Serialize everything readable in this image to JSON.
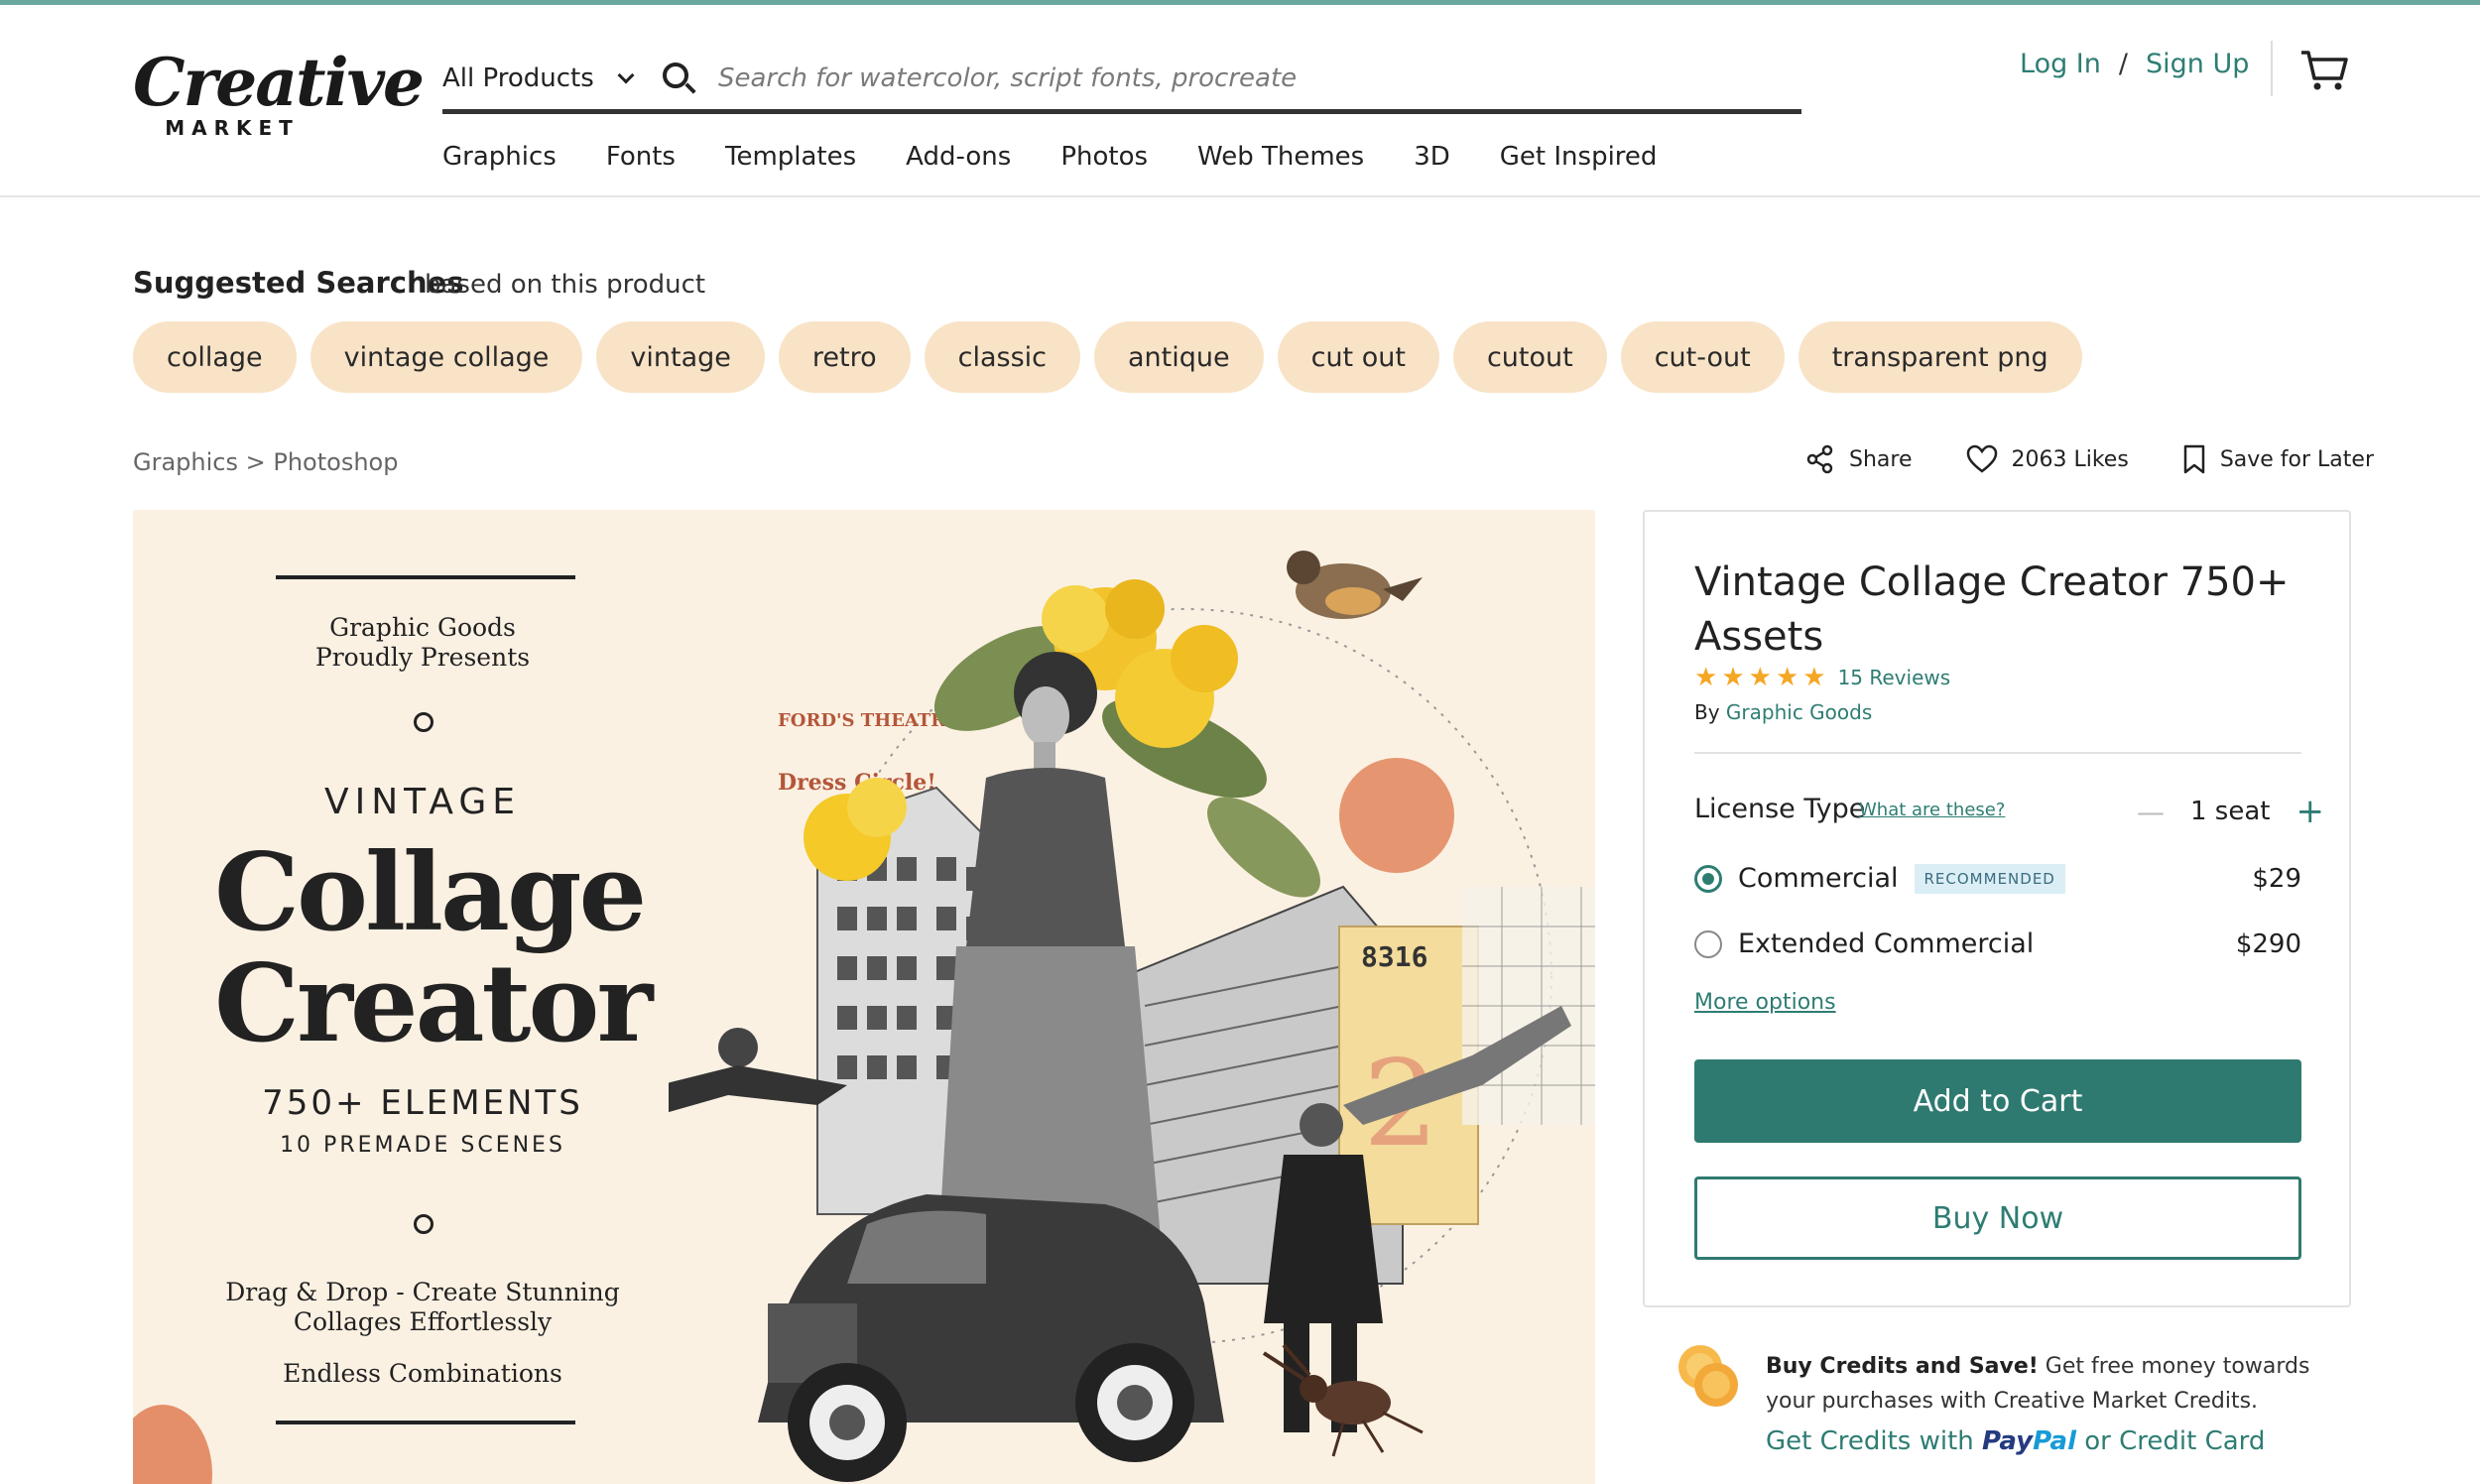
{
  "header": {
    "logo_script": "Creative",
    "logo_sub": "MARKET",
    "category_select": "All Products",
    "search_placeholder": "Search for watercolor, script fonts, procreate",
    "nav": [
      "Graphics",
      "Fonts",
      "Templates",
      "Add-ons",
      "Photos",
      "Web Themes",
      "3D",
      "Get Inspired"
    ],
    "login": "Log In",
    "auth_sep": "/",
    "signup": "Sign Up"
  },
  "suggested": {
    "title": "Suggested Searches",
    "subtitle": "based on this product",
    "chips": [
      "collage",
      "vintage collage",
      "vintage",
      "retro",
      "classic",
      "antique",
      "cut out",
      "cutout",
      "cut-out",
      "transparent png"
    ]
  },
  "breadcrumb": "Graphics > Photoshop",
  "actions": {
    "share": "Share",
    "likes": "2063 Likes",
    "save": "Save for Later"
  },
  "hero": {
    "presents_line1": "Graphic Goods",
    "presents_line2": "Proudly Presents",
    "kicker": "VINTAGE",
    "title_line1": "Collage",
    "title_line2": "Creator",
    "elements": "750+ ELEMENTS",
    "scenes": "10 PREMADE SCENES",
    "tagline_line1": "Drag & Drop - Create Stunning",
    "tagline_line2": "Collages Effortlessly",
    "tagline_line3": "Endless Combinations",
    "ticket_number": "8316",
    "theatre_text": "FORD'S THEATRE",
    "dress_text": "Dress Circle!"
  },
  "product": {
    "title": "Vintage Collage Creator 750+ Assets",
    "rating": 5,
    "reviews": "15 Reviews",
    "by_label": "By",
    "author": "Graphic Goods",
    "license_label": "License Type",
    "license_help": "What are these?",
    "seat_minus": "—",
    "seats": "1 seat",
    "seat_plus": "+",
    "options": [
      {
        "name": "Commercial",
        "badge": "RECOMMENDED",
        "price": "$29",
        "selected": true
      },
      {
        "name": "Extended Commercial",
        "badge": "",
        "price": "$290",
        "selected": false
      }
    ],
    "more_options": "More options",
    "add_to_cart": "Add to Cart",
    "buy_now": "Buy Now"
  },
  "credits": {
    "bold": "Buy Credits and Save!",
    "text": " Get free money towards your purchases with Creative Market Credits.",
    "link_prefix": "Get Credits with",
    "paypal_pay": "Pay",
    "paypal_pal": "Pal",
    "link_suffix": "or Credit Card"
  },
  "colors": {
    "accent": "#2f7a70",
    "chip_bg": "#f9e3c7",
    "hero_bg": "#fbf1e3",
    "top_accent": "#6aa89f"
  }
}
